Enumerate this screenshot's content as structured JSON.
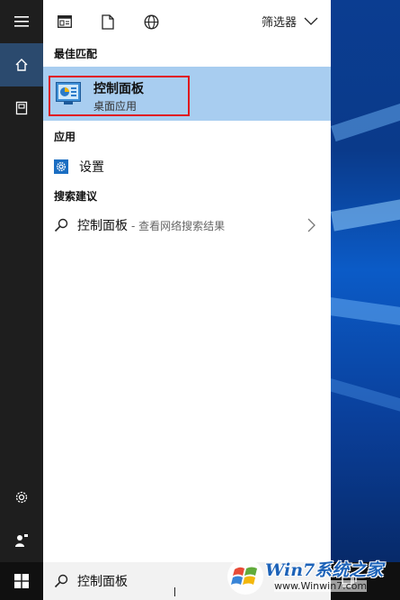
{
  "toolbar": {
    "filter_label": "筛选器"
  },
  "sections": {
    "best_match": "最佳匹配",
    "apps": "应用",
    "search_suggestions": "搜索建议"
  },
  "best_match_item": {
    "title": "控制面板",
    "subtitle": "桌面应用"
  },
  "apps_item": {
    "label": "设置"
  },
  "suggestion_item": {
    "query": "控制面板",
    "hint": "- 查看网络搜索结果"
  },
  "taskbar": {
    "search_value": "控制面板"
  },
  "watermark": {
    "brand": "Win7系统之家",
    "url": "www.Winwin7.com"
  },
  "colors": {
    "highlight": "#a8cdf0",
    "annotation_box": "#e0161c",
    "rail": "#1e1e1e",
    "taskbar": "#101010"
  }
}
